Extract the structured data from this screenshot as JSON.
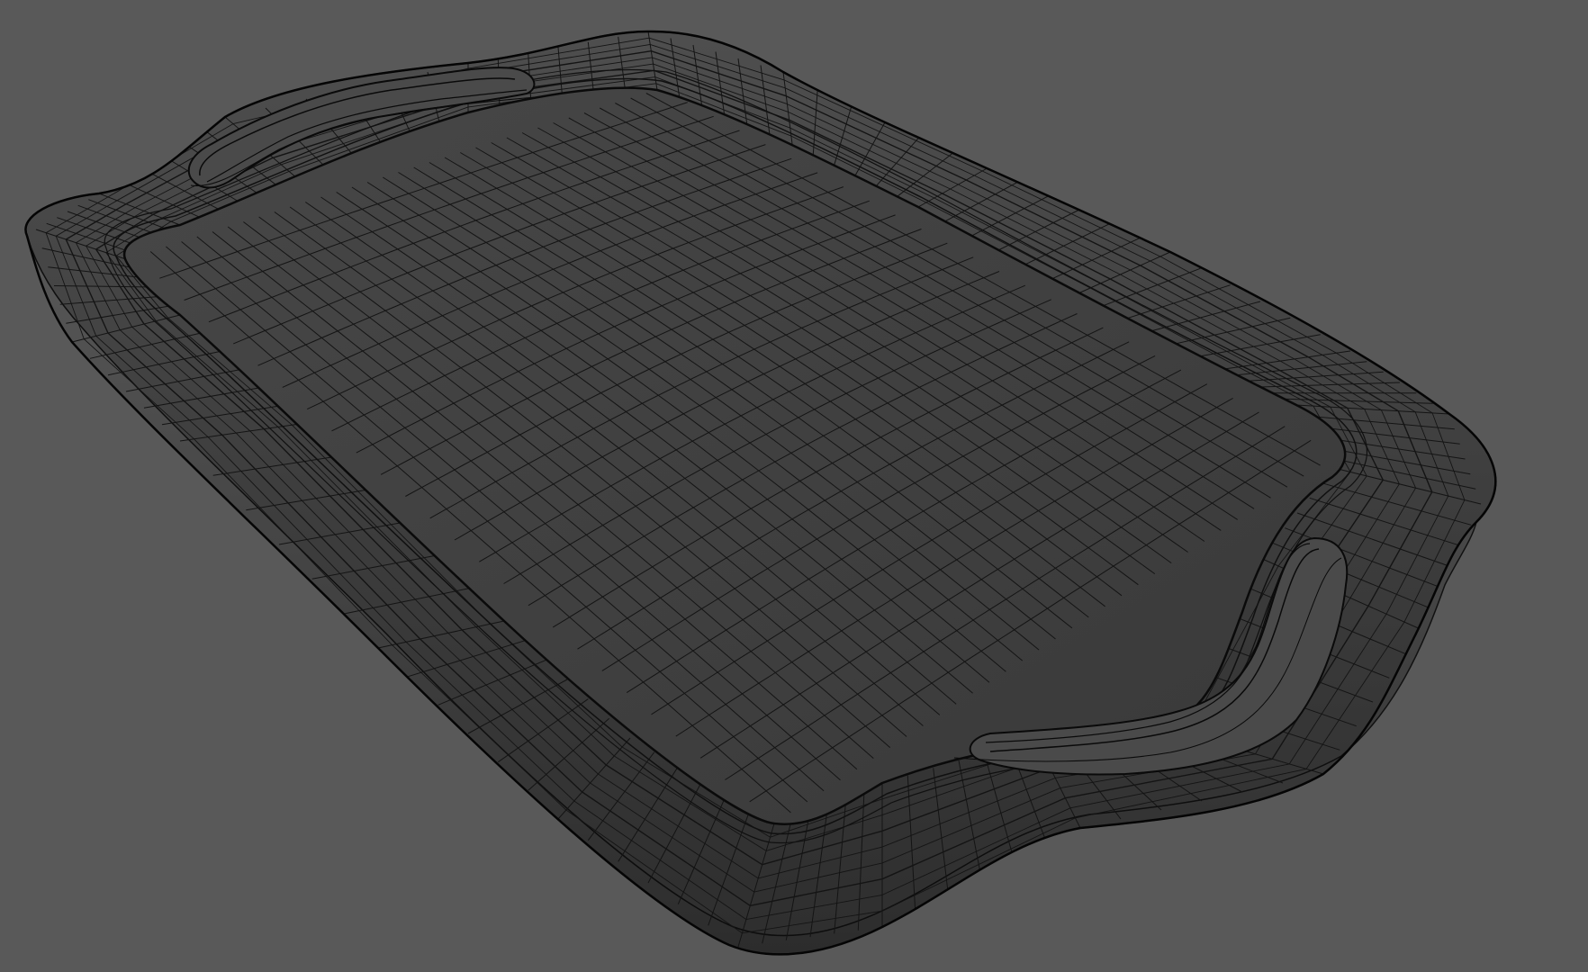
{
  "viewport": {
    "background_color": "#595959",
    "shading": "wireframe-on-shaded",
    "object": "tray",
    "colors": {
      "surface_dark": "#3d3d3d",
      "surface_mid": "#4a4a4a",
      "surface_light": "#5e5e5e",
      "wire": "#141414",
      "outline": "#0a0a0a"
    }
  }
}
